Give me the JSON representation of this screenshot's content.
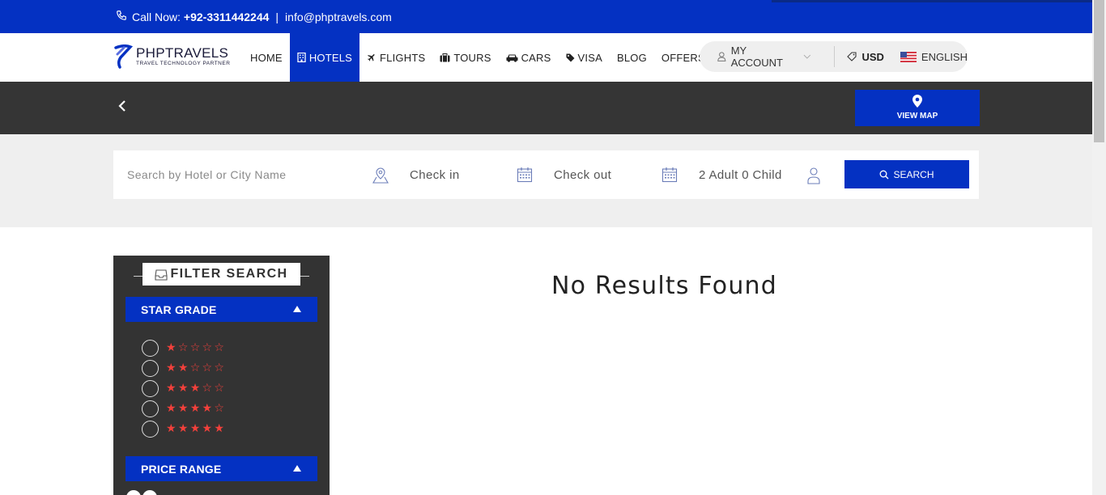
{
  "topbar": {
    "call_label": "Call Now:",
    "phone": "+92-3311442244",
    "separator": "|",
    "email": "info@phptravels.com"
  },
  "logo": {
    "brand": "PHPTRAVELS",
    "tagline": "TRAVEL TECHNOLOGY PARTNER"
  },
  "nav": {
    "items": [
      {
        "label": "HOME",
        "icon": ""
      },
      {
        "label": "HOTELS",
        "icon": "building-icon",
        "active": true
      },
      {
        "label": "FLIGHTS",
        "icon": "plane-icon"
      },
      {
        "label": "TOURS",
        "icon": "suitcase-icon"
      },
      {
        "label": "CARS",
        "icon": "car-icon"
      },
      {
        "label": "VISA",
        "icon": "tag-icon"
      },
      {
        "label": "BLOG",
        "icon": ""
      },
      {
        "label": "OFFERS",
        "icon": ""
      }
    ]
  },
  "account": {
    "my_account": "MY ACCOUNT",
    "currency": "USD",
    "language": "ENGLISH"
  },
  "band": {
    "view_map": "VIEW MAP"
  },
  "search": {
    "city_placeholder": "Search by Hotel or City Name",
    "checkin": "Check in",
    "checkout": "Check out",
    "guests": "2 Adult 0 Child",
    "button": "SEARCH"
  },
  "sidebar": {
    "title": "FILTER SEARCH",
    "star_grade": "STAR GRADE",
    "price_range": "PRICE RANGE",
    "star_rows": [
      "★☆☆☆☆",
      "★★☆☆☆",
      "★★★☆☆",
      "★★★★☆",
      "★★★★★"
    ]
  },
  "results": {
    "message": "No Results Found"
  },
  "colors": {
    "primary": "#0431c2",
    "dark_band": "#353535",
    "sidebar": "#333333",
    "star": "#f2403b",
    "search_bg": "#efefef"
  }
}
